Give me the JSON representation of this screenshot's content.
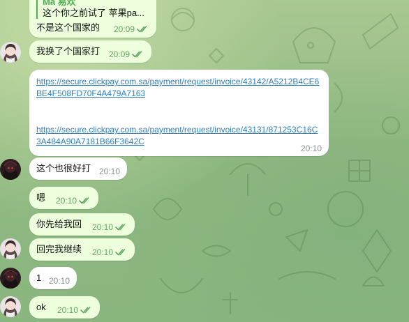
{
  "messages": [
    {
      "reply_to_name": "Ma 易欢",
      "reply_to_text": "这个你之前试了 苹果pa...",
      "text": "不是这个国家的",
      "time": "20:09",
      "status_icon": "double-check-icon"
    },
    {
      "text": "我换了个国家打",
      "time": "20:09",
      "status_icon": "double-check-icon"
    },
    {
      "links": [
        "https://secure.clickpay.com.sa/payment/request/invoice/43142/A5212B4CE6BE4F508FD70F4A479A7163",
        "https://secure.clickpay.com.sa/payment/request/invoice/43131/871253C16C3A484A90A7181B66F3642C"
      ],
      "time": "20:10"
    },
    {
      "text": "这个也很好打",
      "time": "20:10"
    },
    {
      "text": "嗯",
      "time": "20:10",
      "status_icon": "double-check-icon"
    },
    {
      "text": "你先给我回",
      "time": "20:10",
      "status_icon": "double-check-icon"
    },
    {
      "text": "回完我继续",
      "time": "20:10",
      "status_icon": "double-check-icon"
    },
    {
      "text": "1",
      "time": "20:10"
    },
    {
      "text": "ok",
      "time": "20:10",
      "status_icon": "double-check-icon"
    }
  ],
  "avatars": {
    "self": "girl-avatar-icon",
    "contact": "dark-hooded-avatar-icon"
  },
  "colors": {
    "outgoing_bubble": "#eeffde",
    "incoming_bubble": "#ffffff",
    "timestamp_outgoing": "#5fa561",
    "link": "#2f7fc1",
    "reply_accent": "#4fae4e",
    "chat_background": "#97bd86"
  }
}
